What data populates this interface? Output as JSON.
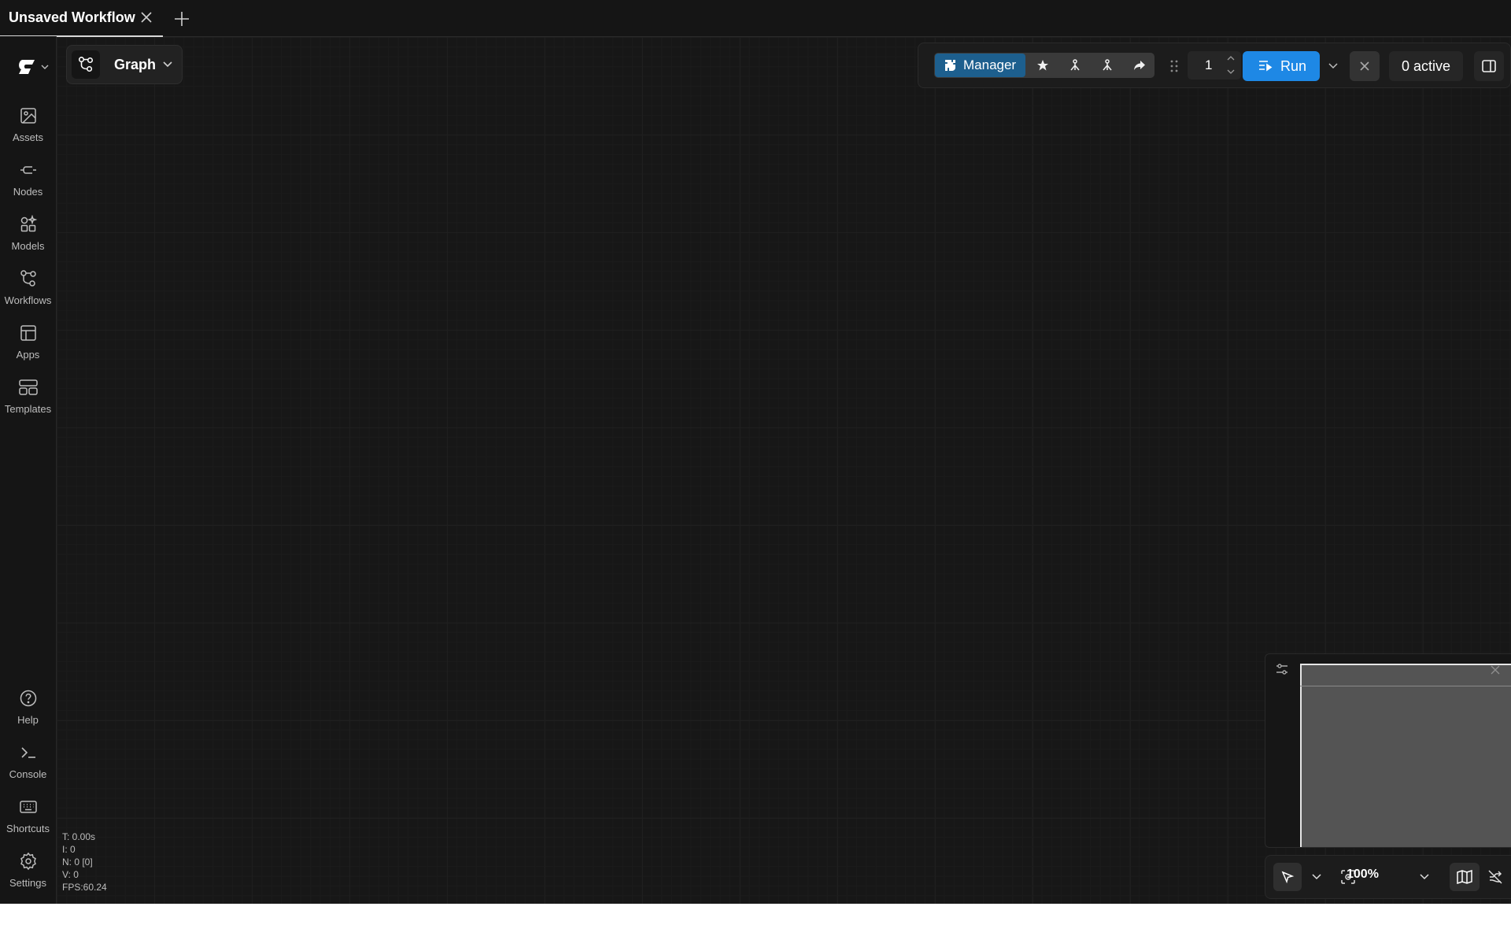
{
  "tab": {
    "title": "Unsaved Workflow"
  },
  "sidebar": {
    "items": [
      {
        "label": "Assets"
      },
      {
        "label": "Nodes"
      },
      {
        "label": "Models"
      },
      {
        "label": "Workflows"
      },
      {
        "label": "Apps"
      },
      {
        "label": "Templates"
      }
    ],
    "bottom_items": [
      {
        "label": "Help"
      },
      {
        "label": "Console"
      },
      {
        "label": "Shortcuts"
      },
      {
        "label": "Settings"
      }
    ]
  },
  "graph_menu": {
    "label": "Graph"
  },
  "toolbar": {
    "manager_label": "Manager",
    "queue_count": "1",
    "run_label": "Run",
    "active_label": "0 active"
  },
  "bottom_toolbar": {
    "zoom": "100%"
  },
  "stats": {
    "t": "T: 0.00s",
    "i": "I: 0",
    "n": "N: 0 [0]",
    "v": "V: 0",
    "fps": "FPS:60.24"
  },
  "colors": {
    "accent": "#1e88e5",
    "manager": "#1d5f8e",
    "background": "#171717"
  }
}
